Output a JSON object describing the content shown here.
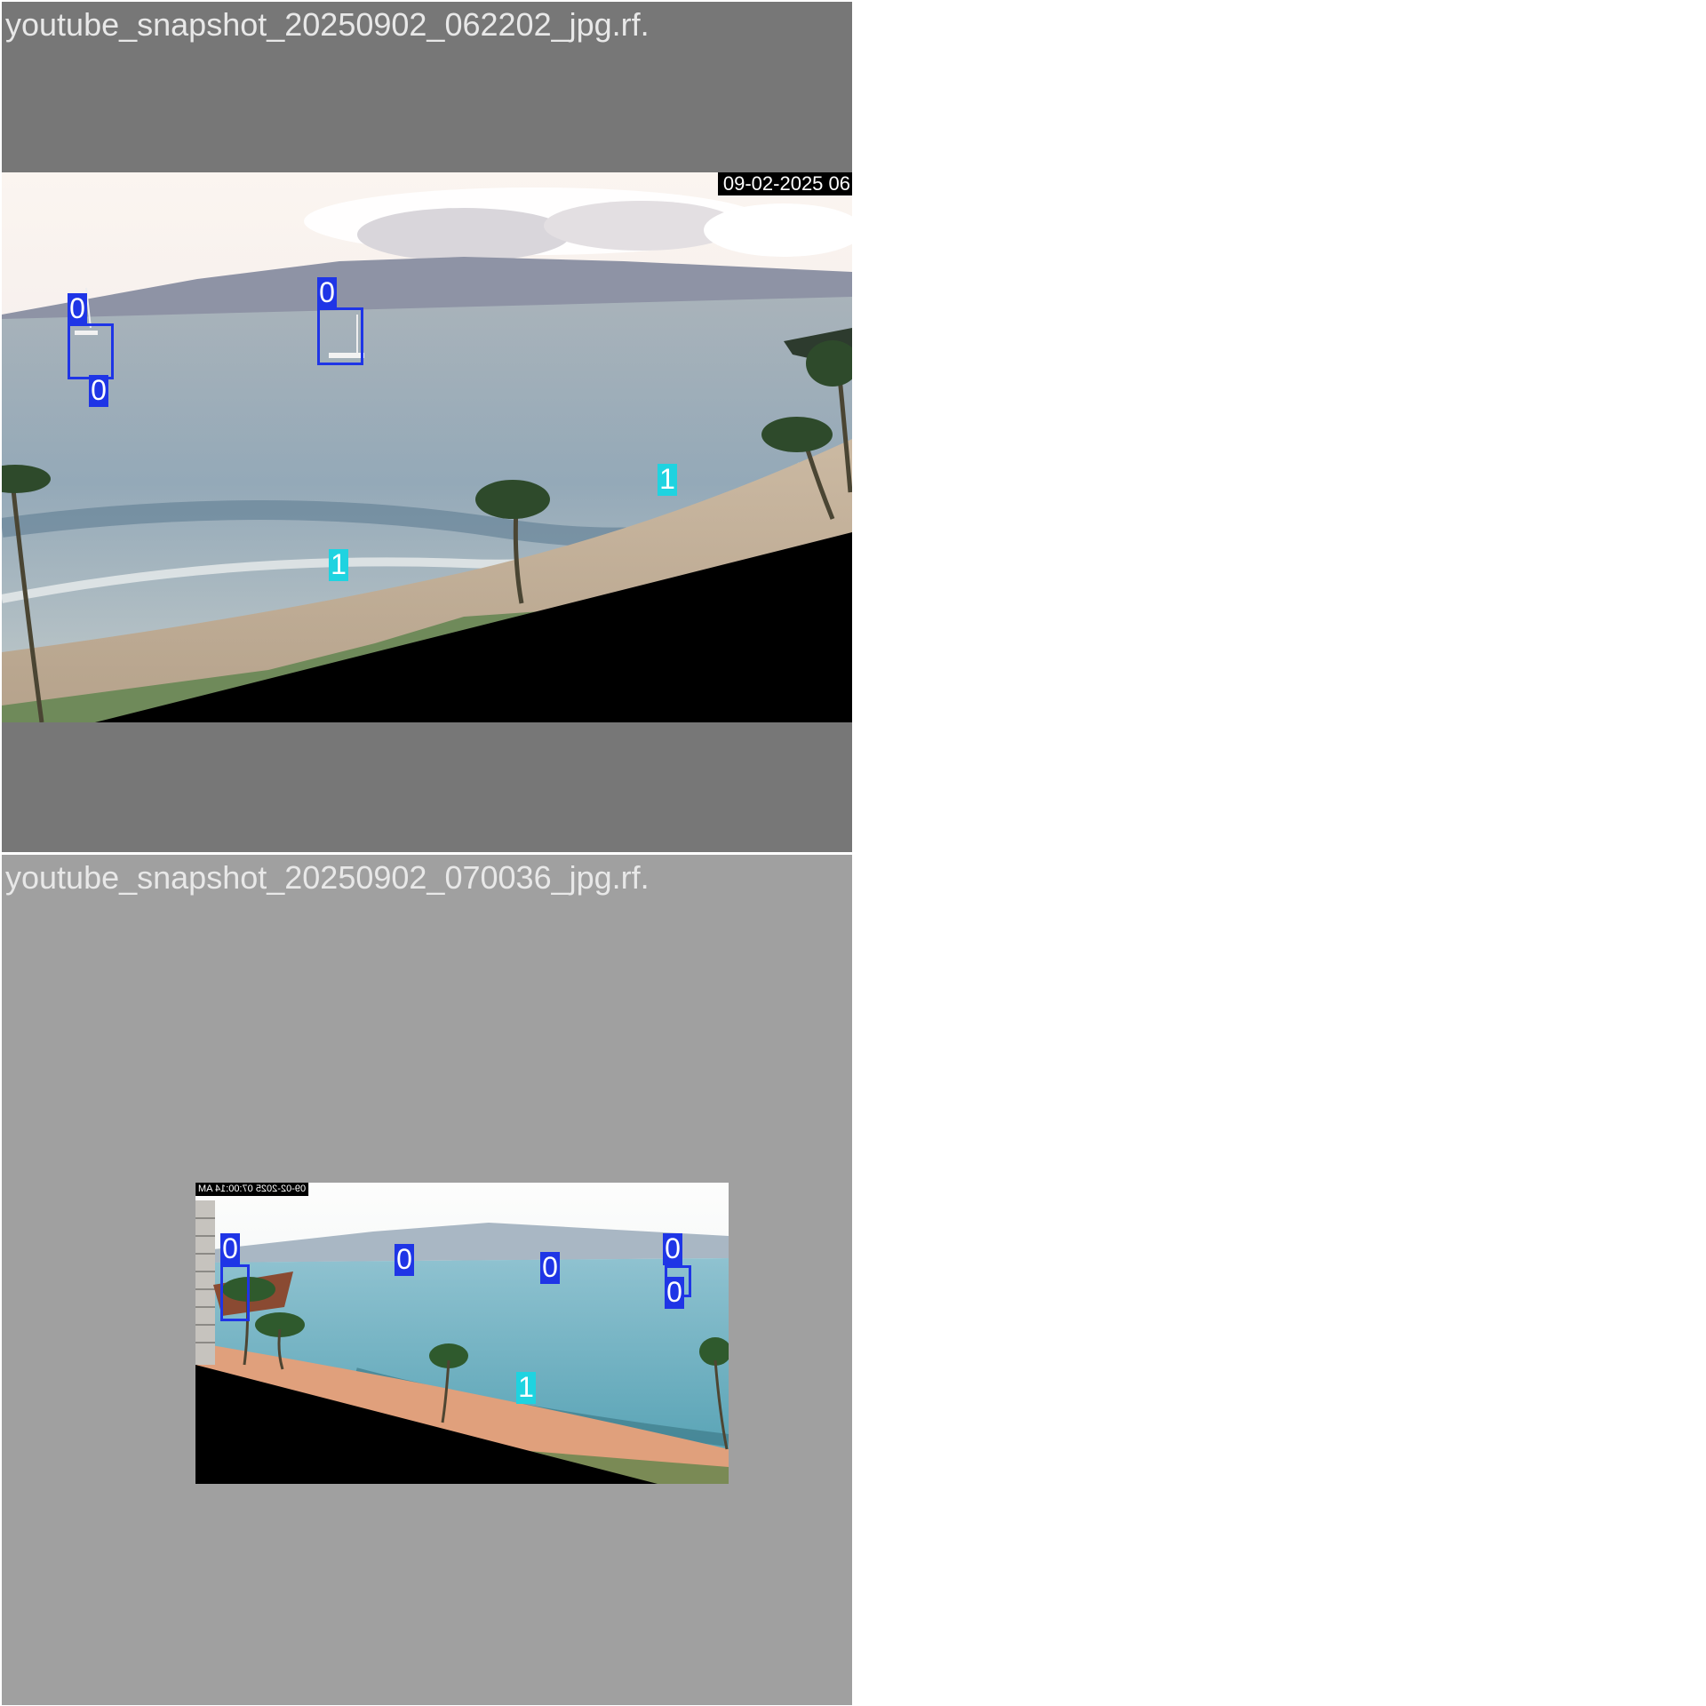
{
  "tiles": [
    {
      "title": "youtube_snapshot_20250902_062202_jpg.rf.",
      "background": "#777777",
      "timestamp": "09-02-2025 06",
      "detections": [
        {
          "class_label": "0",
          "color": "#1f35e6"
        },
        {
          "class_label": "0",
          "color": "#1f35e6"
        },
        {
          "class_label": "0",
          "color": "#1f35e6"
        },
        {
          "class_label": "1",
          "color": "#1fd3e0"
        },
        {
          "class_label": "1",
          "color": "#1fd3e0"
        }
      ]
    },
    {
      "title": "youtube_snapshot_20250902_070036_jpg.rf.",
      "background": "#a0a0a0",
      "timestamp": "09-02-2025 07:00:14 AM",
      "detections": [
        {
          "class_label": "0",
          "color": "#1f35e6"
        },
        {
          "class_label": "0",
          "color": "#1f35e6"
        },
        {
          "class_label": "0",
          "color": "#1f35e6"
        },
        {
          "class_label": "0",
          "color": "#1f35e6"
        },
        {
          "class_label": "0",
          "color": "#1f35e6"
        },
        {
          "class_label": "1",
          "color": "#1fd3e0"
        }
      ]
    }
  ]
}
